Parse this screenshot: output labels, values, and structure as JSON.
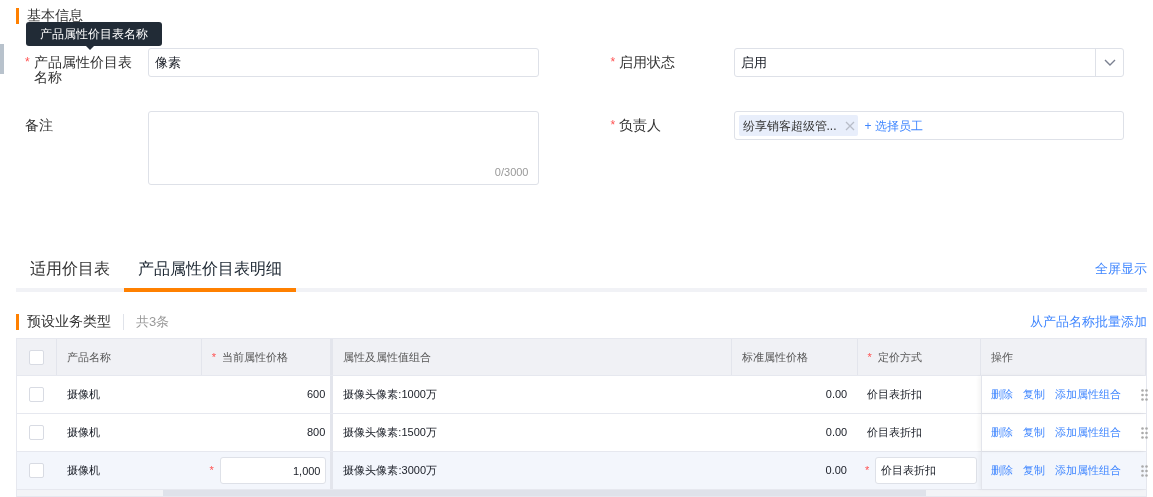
{
  "section_title": "基本信息",
  "tooltip": "产品属性价目表名称",
  "form": {
    "fields": [
      {
        "label": "产品属性价目表名称",
        "required_mark": "*",
        "kind": "text",
        "value": "像素"
      },
      {
        "label": "启用状态",
        "required_mark": "*",
        "kind": "select",
        "value": "启用"
      },
      {
        "label": "备注",
        "kind": "textarea",
        "counter": "0/3000"
      },
      {
        "label": "负责人",
        "required_mark": "*",
        "kind": "people",
        "tags": [
          "纷享销客超级管..."
        ],
        "add_label": "+ 选择员工"
      }
    ]
  },
  "tabs": [
    {
      "label": "适用价目表",
      "selected": false
    },
    {
      "label": "产品属性价目表明细",
      "selected": true
    }
  ],
  "fullscreen_link": "全屏显示",
  "subsection": {
    "title": "预设业务类型",
    "count": "共3条",
    "batch_link": "从产品名称批量添加"
  },
  "table": {
    "select_all": {
      "checked": false
    },
    "columns": [
      {
        "label": "产品名称"
      },
      {
        "label": "当前属性价格",
        "required_mark": "*"
      },
      {
        "label": "属性及属性值组合"
      },
      {
        "label": "标准属性价格"
      },
      {
        "label": "定价方式",
        "required_mark": "*"
      },
      {
        "label": "操作"
      }
    ],
    "rows": [
      {
        "checked": false,
        "editing": false,
        "name": "摄像机",
        "price": "600",
        "combo": "摄像头像素:1000万",
        "standard": "0.00",
        "pricing": "价目表折扣",
        "actions": [
          "删除",
          "复制",
          "添加属性组合"
        ]
      },
      {
        "checked": false,
        "editing": false,
        "name": "摄像机",
        "price": "800",
        "combo": "摄像头像素:1500万",
        "standard": "0.00",
        "pricing": "价目表折扣",
        "actions": [
          "删除",
          "复制",
          "添加属性组合"
        ]
      },
      {
        "checked": false,
        "editing": true,
        "price_mark": "*",
        "pricing_mark": "*",
        "name": "摄像机",
        "price": "1,000",
        "combo": "摄像头像素:3000万",
        "standard": "0.00",
        "pricing": "价目表折扣",
        "actions": [
          "删除",
          "复制",
          "添加属性组合"
        ]
      }
    ]
  }
}
